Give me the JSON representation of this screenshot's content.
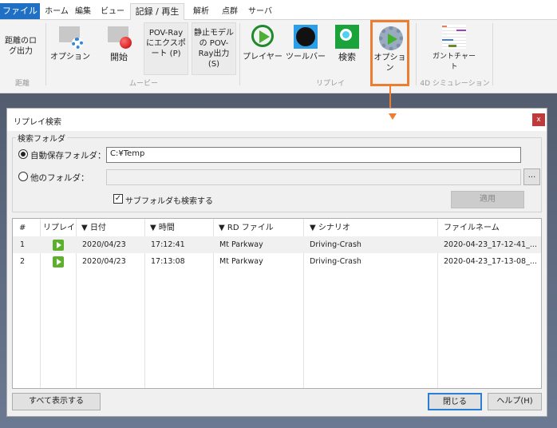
{
  "tabs": [
    "ファイル",
    "ホーム",
    "編集",
    "ビュー",
    "記録 / 再生",
    "解析",
    "点群",
    "サーバ"
  ],
  "ribbon": {
    "distance_log": "距離のログ出力",
    "movie_option": "オプション",
    "start": "開始",
    "pov_export": "POV-Ray にエクスポート (P)",
    "static_pov": "静止モデルの POV-Ray出力 (S)",
    "player": "プレイヤー",
    "toolbar": "ツールバー",
    "search": "検索",
    "replay_option": "オプション",
    "gantt": "ガントチャート",
    "groups": [
      "距離",
      "ムービー",
      "リプレイ",
      "4D シミュレーション"
    ],
    "highlight_color": "#ed7d31"
  },
  "dialog": {
    "title": "リプレイ検索",
    "close": "x",
    "group_label": "検索フォルダ",
    "auto_folder_label": "自動保存フォルダ：",
    "auto_folder_value": "C:¥Temp",
    "other_folder_label": "他のフォルダ：",
    "other_folder_value": "",
    "browse": "...",
    "subfolder_label": "サブフォルダも検索する",
    "subfolder_checked": true,
    "apply": "適用",
    "columns": [
      "#",
      "リプレイ",
      "▼ 日付",
      "▼ 時間",
      "▼ RD ファイル",
      "▼ シナリオ",
      "ファイルネーム"
    ],
    "rows": [
      {
        "n": "1",
        "date": "2020/04/23",
        "time": "17:12:41",
        "rd": "Mt Parkway",
        "scenario": "Driving-Crash",
        "file": "2020-04-23_17-12-41_..."
      },
      {
        "n": "2",
        "date": "2020/04/23",
        "time": "17:13:08",
        "rd": "Mt Parkway",
        "scenario": "Driving-Crash",
        "file": "2020-04-23_17-13-08_..."
      }
    ],
    "show_all": "すべて表示する",
    "close_btn": "閉じる",
    "help": "ヘルプ(H)"
  }
}
